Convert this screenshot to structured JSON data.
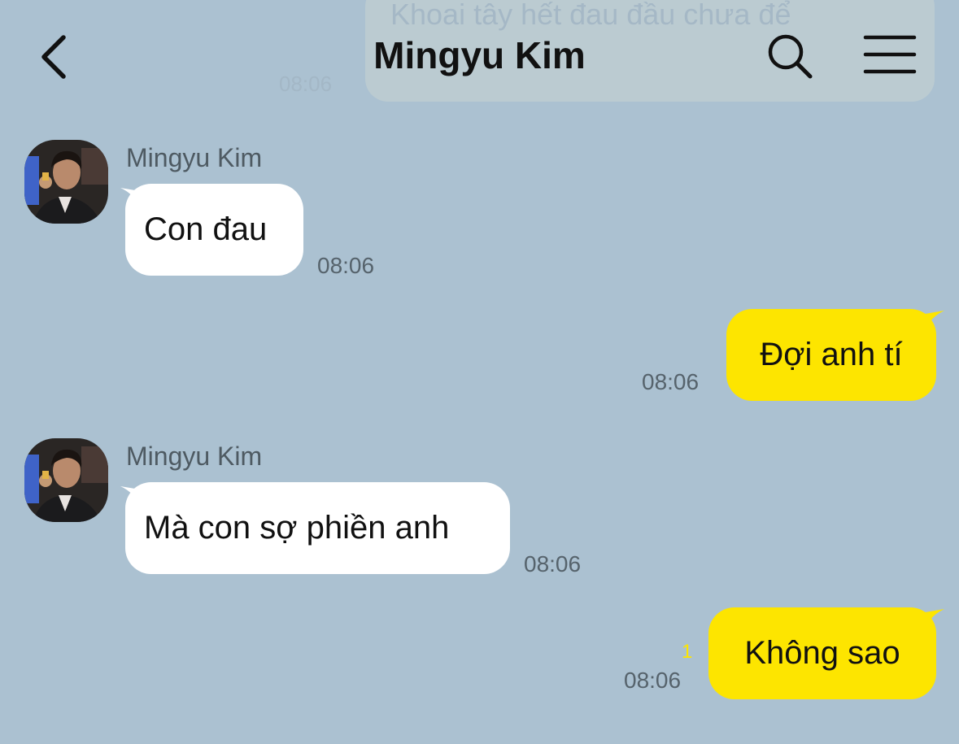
{
  "header": {
    "title": "Mingyu Kim",
    "back_icon": "chevron-left-icon",
    "search_icon": "search-icon",
    "menu_icon": "hamburger-menu-icon"
  },
  "background_message": {
    "text": "Khoai tây hết đau đầu chưa để",
    "time": "08:06"
  },
  "messages": [
    {
      "direction": "incoming",
      "sender": "Mingyu Kim",
      "text": "Con đau",
      "time": "08:06"
    },
    {
      "direction": "outgoing",
      "text": "Đợi anh tí",
      "time": "08:06"
    },
    {
      "direction": "incoming",
      "sender": "Mingyu Kim",
      "text": "Mà con sợ phiền anh",
      "time": "08:06"
    },
    {
      "direction": "outgoing",
      "text": "Không sao",
      "time": "08:06",
      "unread_count": "1"
    }
  ],
  "colors": {
    "background": "#abc1d1",
    "outgoing_bubble": "#fde500",
    "incoming_bubble": "#ffffff",
    "unread_counter": "#fde500"
  }
}
